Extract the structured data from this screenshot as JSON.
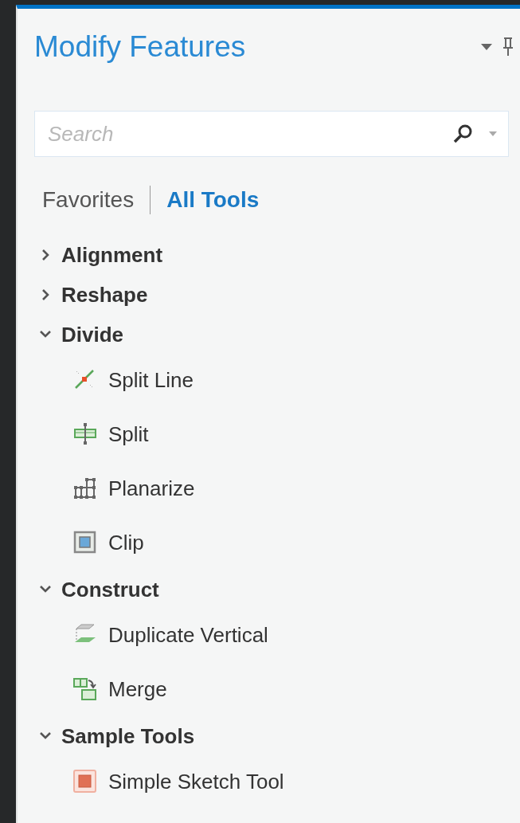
{
  "pane": {
    "title": "Modify Features"
  },
  "search": {
    "placeholder": "Search"
  },
  "tabs": [
    {
      "label": "Favorites",
      "selected": false
    },
    {
      "label": "All Tools",
      "selected": true
    }
  ],
  "groups": [
    {
      "label": "Alignment",
      "expanded": false
    },
    {
      "label": "Reshape",
      "expanded": false
    },
    {
      "label": "Divide",
      "expanded": true,
      "tools": [
        {
          "label": "Split Line",
          "kind": "splitline"
        },
        {
          "label": "Split",
          "kind": "split"
        },
        {
          "label": "Planarize",
          "kind": "planarize"
        },
        {
          "label": "Clip",
          "kind": "clip"
        }
      ]
    },
    {
      "label": "Construct",
      "expanded": true,
      "tools": [
        {
          "label": "Duplicate Vertical",
          "kind": "duplicate"
        },
        {
          "label": "Merge",
          "kind": "merge"
        }
      ]
    },
    {
      "label": "Sample Tools",
      "expanded": true,
      "tools": [
        {
          "label": "Simple Sketch Tool",
          "kind": "sketch"
        }
      ]
    }
  ]
}
